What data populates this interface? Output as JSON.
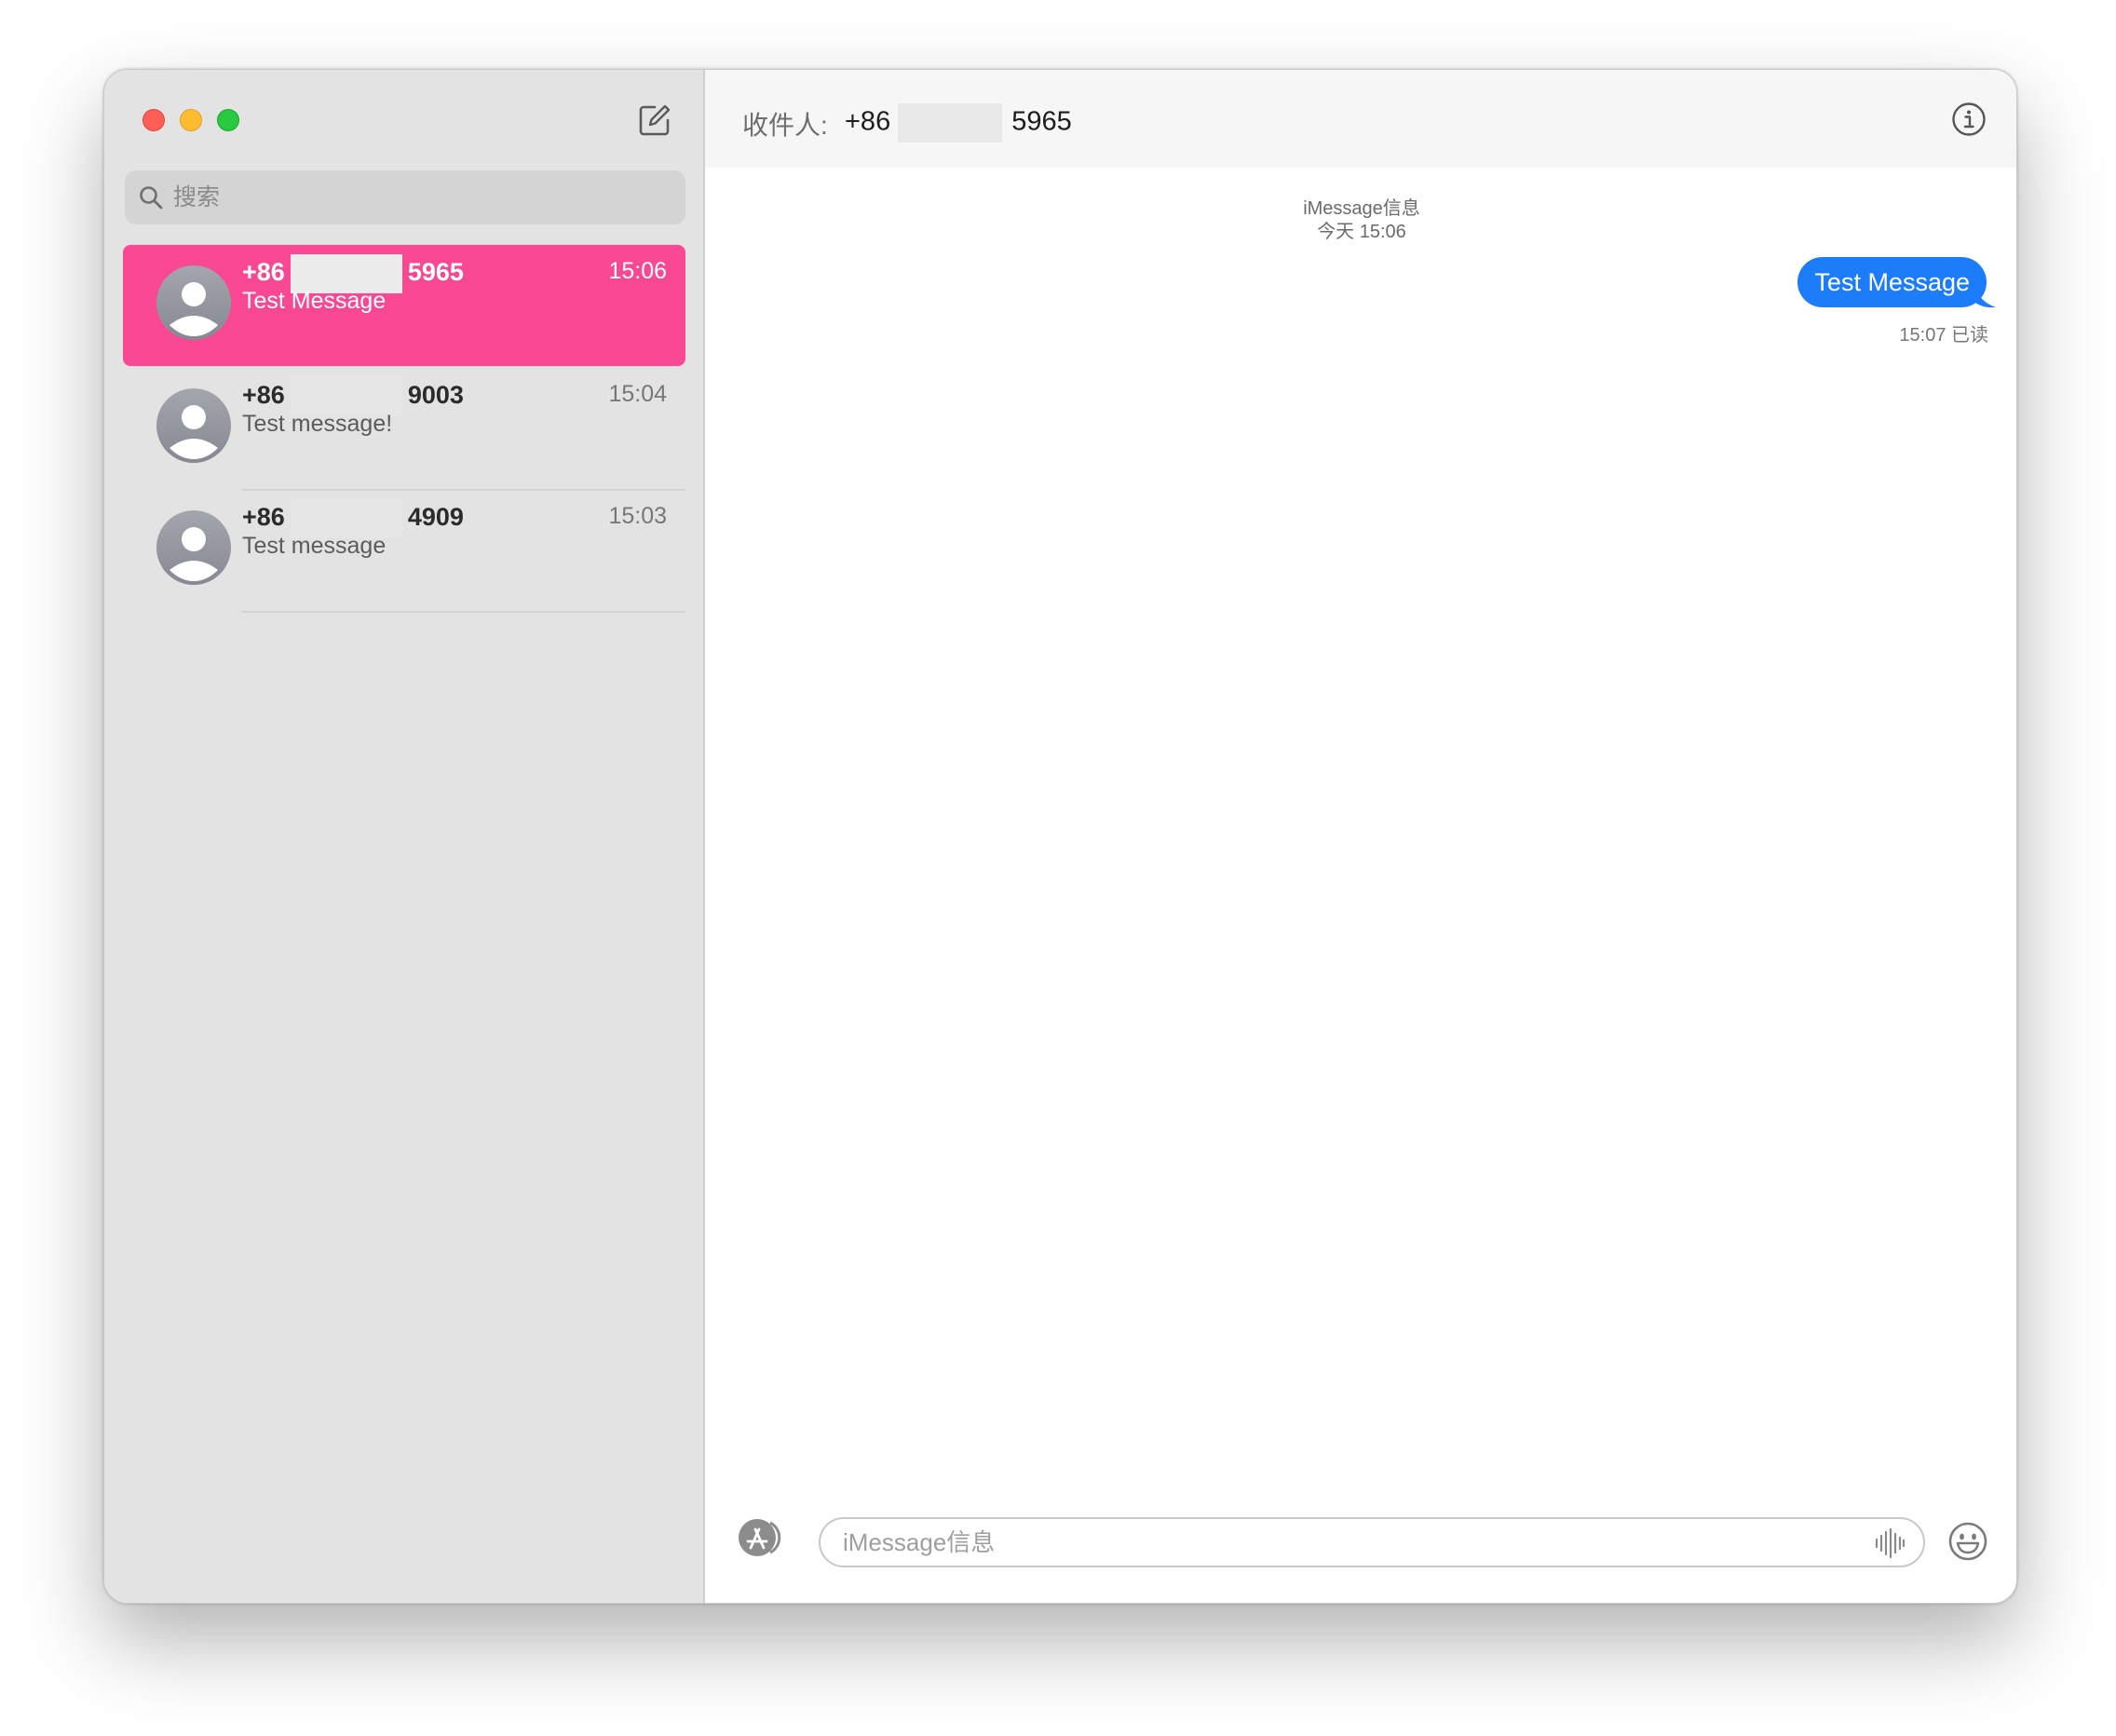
{
  "window": {
    "controls": [
      "close",
      "minimize",
      "zoom"
    ]
  },
  "sidebar": {
    "compose_icon": "compose-icon",
    "search": {
      "placeholder": "搜索",
      "value": ""
    },
    "conversations": [
      {
        "prefix": "+86",
        "suffix": "5965",
        "time": "15:06",
        "preview": "Test Message",
        "selected": true
      },
      {
        "prefix": "+86",
        "suffix": "9003",
        "time": "15:04",
        "preview": "Test message!",
        "selected": false
      },
      {
        "prefix": "+86",
        "suffix": "4909",
        "time": "15:03",
        "preview": "Test message",
        "selected": false
      }
    ]
  },
  "header": {
    "to_label": "收件人:",
    "to_prefix": "+86",
    "to_suffix": "5965",
    "info_icon": "info-icon"
  },
  "thread": {
    "service": "iMessage信息",
    "date": "今天 15:06",
    "messages": [
      {
        "text": "Test Message",
        "from_me": true
      }
    ],
    "receipt": "15:07 已读"
  },
  "composer": {
    "placeholder": "iMessage信息",
    "value": "",
    "apps_icon": "app-store-icon",
    "audio_icon": "waveform-icon",
    "emoji_icon": "emoji-icon"
  },
  "colors": {
    "selected_row": "#f84893",
    "bubble": "#1c7cf9",
    "sidebar_bg": "#e3e3e3"
  }
}
